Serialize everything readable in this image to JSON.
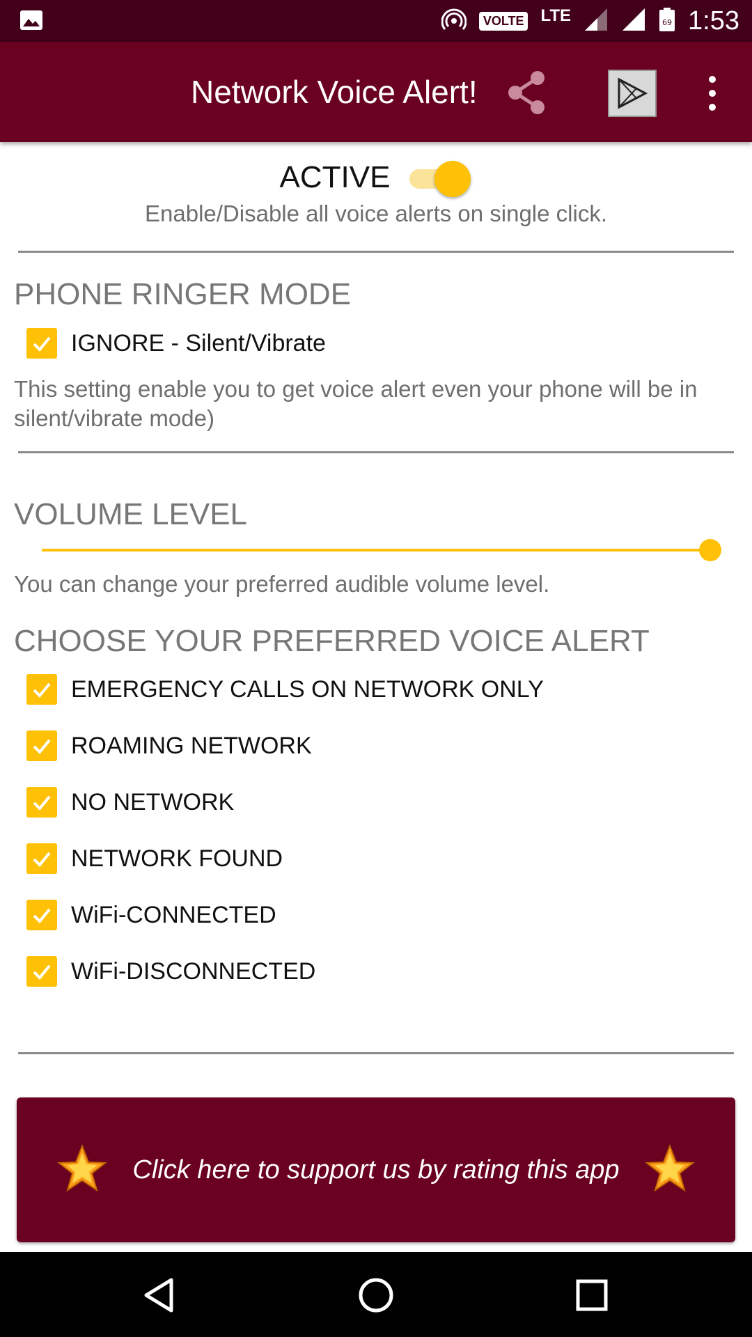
{
  "status_bar": {
    "time": "1:53",
    "volte": "VOLTE",
    "network": "LTE",
    "battery": "69",
    "icons": [
      "image-icon",
      "hotspot-icon",
      "signal-icon",
      "signal-full-icon",
      "battery-icon"
    ]
  },
  "toolbar": {
    "title": "Network Voice Alert!",
    "icons": [
      "share-icon",
      "play-store-icon",
      "more-vert-icon"
    ]
  },
  "master_switch": {
    "label": "ACTIVE",
    "on": true,
    "description": "Enable/Disable all voice alerts on single click."
  },
  "ringer": {
    "heading": "PHONE RINGER MODE",
    "option": {
      "label": "IGNORE - Silent/Vibrate",
      "checked": true
    },
    "description": "This setting enable you to get voice alert even your phone will be in silent/vibrate mode)"
  },
  "volume": {
    "heading": "VOLUME LEVEL",
    "level_fraction": 1.0,
    "description": "You can change your preferred audible volume level."
  },
  "alerts": {
    "heading": "CHOOSE YOUR PREFERRED VOICE ALERT",
    "items": [
      {
        "label": "EMERGENCY CALLS ON NETWORK ONLY",
        "checked": true
      },
      {
        "label": "ROAMING NETWORK",
        "checked": true
      },
      {
        "label": "NO NETWORK",
        "checked": true
      },
      {
        "label": "NETWORK FOUND",
        "checked": true
      },
      {
        "label": "WiFi-CONNECTED",
        "checked": true
      },
      {
        "label": "WiFi-DISCONNECTED",
        "checked": true
      }
    ]
  },
  "rate_banner": {
    "text": "Click here to support us by rating this app"
  },
  "colors": {
    "primary": "#6a0120",
    "status_bar": "#43001a",
    "accent": "#ffc107"
  }
}
